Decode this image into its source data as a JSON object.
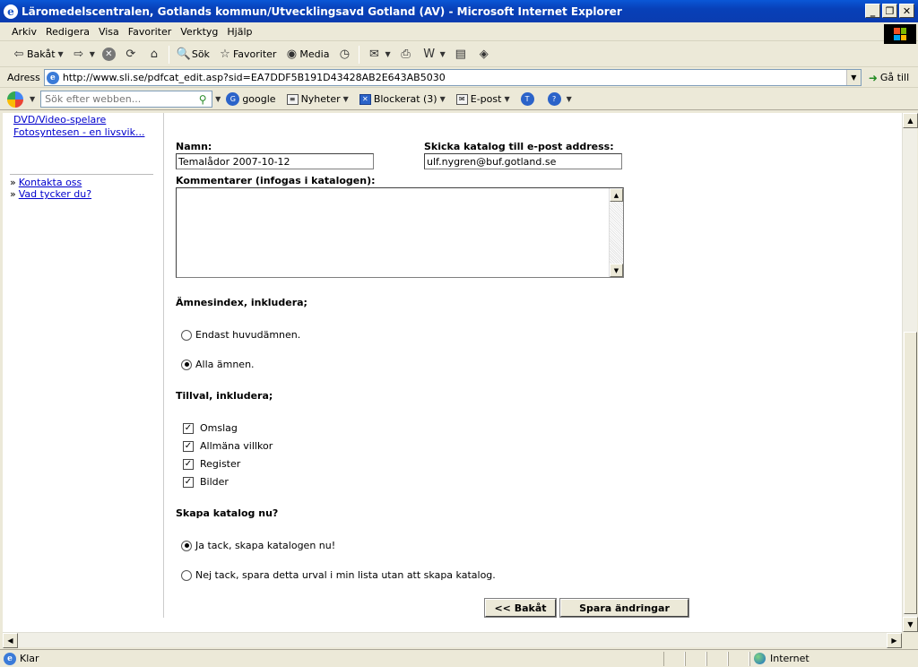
{
  "window": {
    "title": "Läromedelscentralen, Gotlands kommun/Utvecklingsavd Gotland (AV) - Microsoft Internet Explorer",
    "app_icon": "ie-icon",
    "minimize": "_",
    "maximize": "❐",
    "close": "✕"
  },
  "menu": {
    "items": [
      "Arkiv",
      "Redigera",
      "Visa",
      "Favoriter",
      "Verktyg",
      "Hjälp"
    ]
  },
  "toolbar": {
    "back_label": "Bakåt",
    "back_icon": "⇦",
    "forward_icon": "⇨",
    "stop_icon": "✕",
    "refresh_icon": "⟳",
    "home_icon": "⌂",
    "search_label": "Sök",
    "search_icon": "🔍",
    "favorites_label": "Favoriter",
    "favorites_icon": "☆",
    "media_label": "Media",
    "media_icon": "◉",
    "history_icon": "◷",
    "mail_icon": "✉",
    "print_icon": "⎙",
    "edit_icon": "W",
    "discuss_icon": "▤",
    "messenger_icon": "◈"
  },
  "address": {
    "label": "Adress",
    "url": "http://www.sli.se/pdfcat_edit.asp?sid=EA7DDF5B191D43428AB2E643AB5030",
    "go_label": "Gå till",
    "page_icon": "e"
  },
  "google_toolbar": {
    "search_placeholder": "Sök efter webben...",
    "google_label": "google",
    "news_label": "Nyheter",
    "blocked_label": "Blockerat (3)",
    "email_label": "E-post"
  },
  "left_nav": {
    "links": [
      "DVD/Video-spelare",
      "Fotosyntesen - en livsvik..."
    ],
    "bullet": "»",
    "footer_links": [
      "Kontakta oss",
      "Vad tycker du?"
    ]
  },
  "form": {
    "name_label": "Namn:",
    "name_value": "Temalådor 2007-10-12",
    "email_label": "Skicka katalog till e-post address:",
    "email_value": "ulf.nygren@buf.gotland.se",
    "comments_label": "Kommentarer (infogas i katalogen):",
    "comments_value": "",
    "subject_index_heading": "Ämnesindex, inkludera;",
    "subject_options": [
      {
        "label": "Endast huvudämnen.",
        "selected": false
      },
      {
        "label": "Alla ämnen.",
        "selected": true
      }
    ],
    "extras_heading": "Tillval, inkludera;",
    "extras_options": [
      {
        "label": "Omslag",
        "checked": true
      },
      {
        "label": "Allmäna villkor",
        "checked": true
      },
      {
        "label": "Register",
        "checked": true
      },
      {
        "label": "Bilder",
        "checked": true
      }
    ],
    "create_heading": "Skapa katalog nu?",
    "create_options": [
      {
        "label": "Ja tack, skapa katalogen nu!",
        "selected": true
      },
      {
        "label": "Nej tack, spara detta urval i min lista utan att skapa katalog.",
        "selected": false
      }
    ],
    "back_button": "<< Bakåt",
    "save_button": "Spara ändringar",
    "check_mark": "✓"
  },
  "status": {
    "text": "Klar",
    "zone": "Internet"
  },
  "colors": {
    "titlebar": "#0a3cb0",
    "link": "#0000cc",
    "chrome": "#ece9d8"
  }
}
